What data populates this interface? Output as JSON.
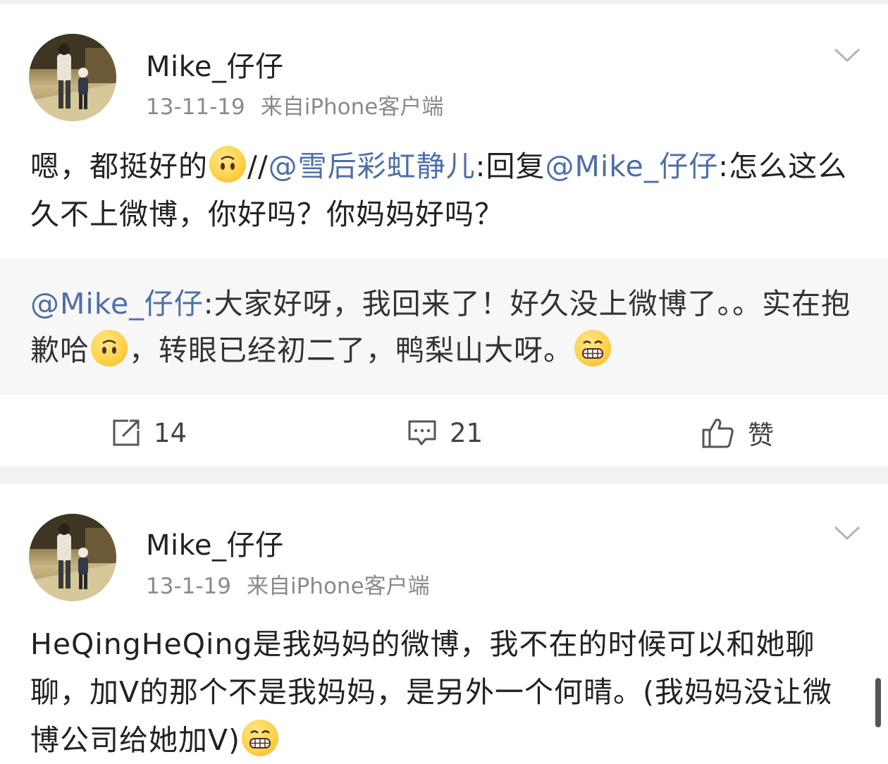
{
  "posts": [
    {
      "author": "Mike_仔仔",
      "date": "13-11-19",
      "source": "来自iPhone客户端",
      "text": {
        "part1": "嗯，都挺好的",
        "slashes": "//",
        "mention1": "@雪后彩虹静儿",
        "part2": ":回复",
        "mention2": "@Mike_仔仔",
        "part3": ":怎么这么久不上微博，你好吗？你妈妈好吗？"
      },
      "repost": {
        "mention": "@Mike_仔仔",
        "part1": ":大家好呀，我回来了！好久没上微博了。。实在抱歉哈",
        "part2": "，转眼已经初二了，鸭梨山大呀。"
      },
      "actions": {
        "repost_count": "14",
        "comment_count": "21",
        "like_label": "赞"
      }
    },
    {
      "author": "Mike_仔仔",
      "date": "13-1-19",
      "source": "来自iPhone客户端",
      "text": {
        "part1": "HeQingHeQing是我妈妈的微博，我不在的时候可以和她聊聊，加V的那个不是我妈妈，是另外一个何晴。(我妈妈没让微博公司给她加V)"
      }
    }
  ],
  "icons": {
    "menu": "chevron-down-icon",
    "repost": "repost-icon",
    "comment": "comment-icon",
    "like": "thumbs-up-icon",
    "emoji_upside": "upside-down-face-icon",
    "emoji_grin": "grin-face-icon"
  },
  "colors": {
    "mention": "#4d6fa8",
    "meta": "#8a8a8a",
    "repost_bg": "#f7f7f7",
    "divider": "#f2f2f2"
  }
}
